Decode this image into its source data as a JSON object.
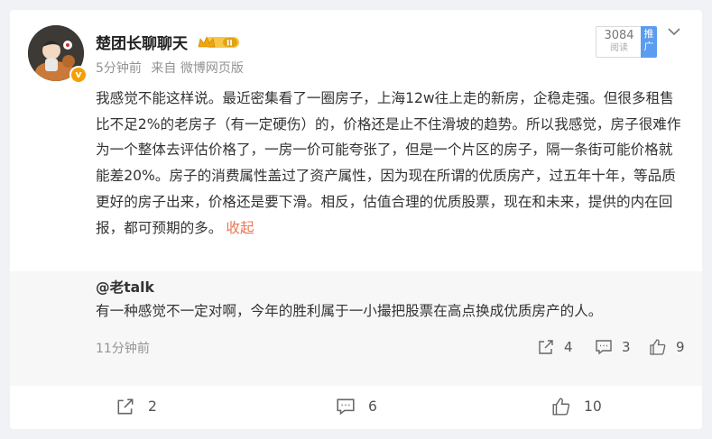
{
  "post": {
    "username": "楚团长聊聊天",
    "time": "5分钟前",
    "source": "来自 微博网页版",
    "read_count": "3084",
    "read_label": "阅读",
    "promo_label": "推广",
    "content": "我感觉不能这样说。最近密集看了一圈房子，上海12w往上走的新房，企稳走强。但很多租售比不足2%的老房子（有一定硬伤）的，价格还是止不住滑坡的趋势。所以我感觉，房子很难作为一个整体去评估价格了，一房一价可能夸张了，但是一个片区的房子，隔一条街可能价格就能差20%。房子的消费属性盖过了资产属性，因为现在所谓的优质房产，过五年十年，等品质更好的房子出来，价格还是要下滑。相反，估值合理的优质股票，现在和未来，提供的内在回报，都可预期的多。",
    "collapse_label": "收起",
    "verified_badge": "v"
  },
  "repost": {
    "user": "@老talk",
    "text": "有一种感觉不一定对啊，今年的胜利属于一小撮把股票在高点换成优质房产的人。",
    "time": "11分钟前",
    "shares": "4",
    "comments": "3",
    "likes": "9"
  },
  "footer": {
    "shares": "2",
    "comments": "6",
    "likes": "10"
  },
  "colors": {
    "accent_orange": "#eb7350",
    "promo_blue": "#5a9cf0",
    "meta_gray": "#939393"
  },
  "icons": [
    "verified-badge-icon",
    "crown-level-icon",
    "chevron-down-icon",
    "share-icon",
    "comment-icon",
    "like-icon"
  ]
}
